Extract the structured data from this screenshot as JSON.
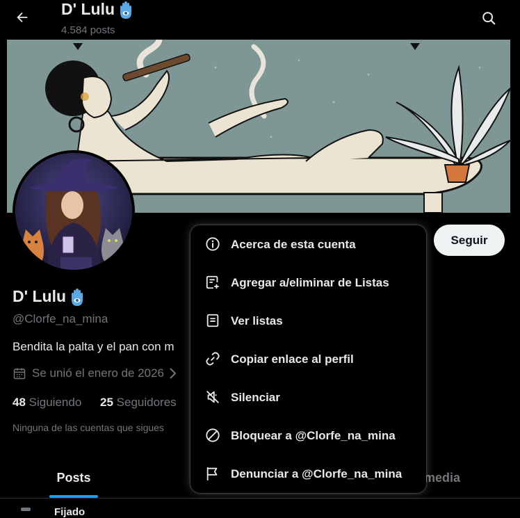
{
  "header": {
    "title": "D' Lulu",
    "posts_count": "4.584 posts"
  },
  "profile": {
    "name": "D' Lulu",
    "handle": "@Clorfe_na_mina",
    "bio": "Bendita la palta y el pan con m",
    "joined": "Se unió el enero de 2026",
    "following_count": "48",
    "following_label": "Siguiendo",
    "followers_count": "25",
    "followers_label": "Seguidores",
    "followed_by_note": "Ninguna de las cuentas que sigues",
    "follow_button": "Seguir"
  },
  "tabs": {
    "posts": "Posts",
    "media": "media"
  },
  "bottom_peek": "Fijado",
  "menu": {
    "items": [
      {
        "label": "Acerca de esta cuenta",
        "icon": "info-icon"
      },
      {
        "label": "Agregar a/eliminar de Listas",
        "icon": "list-add-icon"
      },
      {
        "label": "Ver listas",
        "icon": "list-icon"
      },
      {
        "label": "Copiar enlace al perfil",
        "icon": "link-icon"
      },
      {
        "label": "Silenciar",
        "icon": "mute-icon"
      },
      {
        "label": "Bloquear a @Clorfe_na_mina",
        "icon": "block-icon"
      },
      {
        "label": "Denunciar a @Clorfe_na_mina",
        "icon": "flag-icon"
      }
    ]
  },
  "colors": {
    "accent": "#1d9bf0",
    "background": "#000000",
    "text_primary": "#e7e9ea",
    "text_secondary": "#71767b"
  }
}
